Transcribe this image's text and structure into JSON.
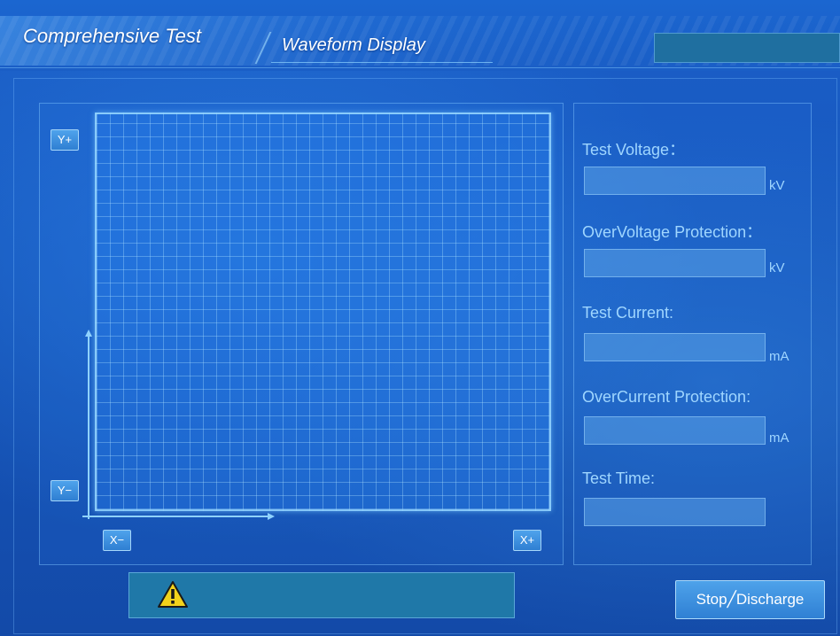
{
  "header": {
    "tab_comprehensive": "Comprehensive Test",
    "tab_waveform": "Waveform Display",
    "status_text": ""
  },
  "waveform": {
    "y_plus": "Y+",
    "y_minus": "Y−",
    "x_minus": "X−",
    "x_plus": "X+"
  },
  "params": {
    "test_voltage": {
      "label": "Test Voltage：",
      "value": "",
      "unit": "kV"
    },
    "overvoltage_protection": {
      "label": "OverVoltage Protection：",
      "value": "",
      "unit": "kV"
    },
    "test_current": {
      "label": "Test Current:",
      "value": "",
      "unit": "mA"
    },
    "overcurrent_protection": {
      "label": "OverCurrent Protection:",
      "value": "",
      "unit": "mA"
    },
    "test_time": {
      "label": "Test Time:",
      "value": ""
    }
  },
  "footer": {
    "alarm_text": "",
    "stop_discharge_label": "Stop╱Discharge"
  },
  "colors": {
    "background": "#1656bd",
    "accent_text": "#9fd6ff",
    "button": "#3a8ddf",
    "alarm_bar": "#1f78a8",
    "warning_icon": "#f2d21b"
  },
  "icons": {
    "warning": "warning-triangle-icon"
  }
}
